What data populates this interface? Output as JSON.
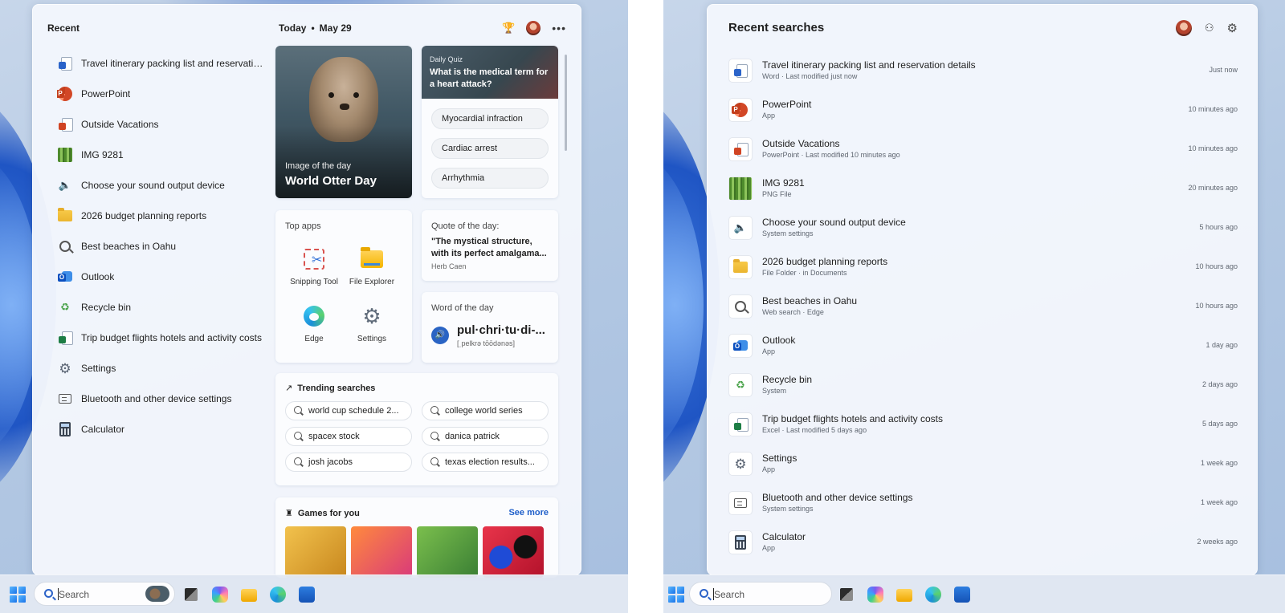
{
  "left": {
    "recent_title": "Recent",
    "recent_items": [
      {
        "label": "Travel itinerary packing list and reservation...",
        "icon": "word-doc-icon"
      },
      {
        "label": "PowerPoint",
        "icon": "powerpoint-icon"
      },
      {
        "label": "Outside Vacations",
        "icon": "powerpoint-file-icon"
      },
      {
        "label": "IMG 9281",
        "icon": "image-thumbnail-icon"
      },
      {
        "label": "Choose your sound output device",
        "icon": "speaker-icon"
      },
      {
        "label": "2026 budget planning reports",
        "icon": "folder-icon"
      },
      {
        "label": "Best beaches in Oahu",
        "icon": "search-icon"
      },
      {
        "label": "Outlook",
        "icon": "outlook-icon"
      },
      {
        "label": "Recycle bin",
        "icon": "recycle-bin-icon"
      },
      {
        "label": "Trip budget flights hotels and activity costs",
        "icon": "excel-file-icon"
      },
      {
        "label": "Settings",
        "icon": "gear-icon"
      },
      {
        "label": "Bluetooth and other device settings",
        "icon": "bluetooth-devices-icon"
      },
      {
        "label": "Calculator",
        "icon": "calculator-icon"
      }
    ],
    "today_label": "Today",
    "today_separator": "•",
    "today_date": "May 29",
    "image_of_day": {
      "subtitle": "Image of the day",
      "title": "World Otter Day"
    },
    "quiz": {
      "category": "Daily Quiz",
      "question": "What is the medical term for a heart attack?",
      "options": [
        "Myocardial infraction",
        "Cardiac arrest",
        "Arrhythmia"
      ]
    },
    "top_apps": {
      "title": "Top apps",
      "apps": [
        {
          "label": "Snipping Tool"
        },
        {
          "label": "File Explorer"
        },
        {
          "label": "Edge"
        },
        {
          "label": "Settings"
        }
      ]
    },
    "quote": {
      "label": "Quote of the day:",
      "line1": "\"The mystical structure,",
      "line2": "with its perfect amalgama...",
      "author": "Herb Caen"
    },
    "word": {
      "label": "Word of the day",
      "word": "pul·chri·tu·di-...",
      "pronunciation": "[ˌpelkrə tōōdənəs]"
    },
    "trending": {
      "title": "Trending searches",
      "items": [
        "world cup schedule 2...",
        "college world series",
        "spacex stock",
        "danica patrick",
        "josh jacobs",
        "texas election results..."
      ]
    },
    "games": {
      "title": "Games for you",
      "see_more": "See more"
    }
  },
  "right": {
    "title": "Recent searches",
    "items": [
      {
        "name": "Travel itinerary packing list and reservation details",
        "sub": "Word · Last modified just now",
        "time": "Just now",
        "icon": "word-doc-icon"
      },
      {
        "name": "PowerPoint",
        "sub": "App",
        "time": "10 minutes ago",
        "icon": "powerpoint-icon"
      },
      {
        "name": "Outside Vacations",
        "sub": "PowerPoint · Last modified 10 minutes ago",
        "time": "10 minutes ago",
        "icon": "powerpoint-file-icon"
      },
      {
        "name": "IMG 9281",
        "sub": "PNG File",
        "time": "20 minutes ago",
        "icon": "image-thumbnail-icon"
      },
      {
        "name": "Choose your sound output device",
        "sub": "System settings",
        "time": "5 hours ago",
        "icon": "speaker-icon"
      },
      {
        "name": "2026 budget planning reports",
        "sub": "File Folder · in Documents",
        "time": "10 hours ago",
        "icon": "folder-icon"
      },
      {
        "name": "Best beaches in Oahu",
        "sub": "Web search · Edge",
        "time": "10 hours ago",
        "icon": "search-icon"
      },
      {
        "name": "Outlook",
        "sub": "App",
        "time": "1 day ago",
        "icon": "outlook-icon"
      },
      {
        "name": "Recycle bin",
        "sub": "System",
        "time": "2 days ago",
        "icon": "recycle-bin-icon"
      },
      {
        "name": "Trip budget flights hotels and activity costs",
        "sub": "Excel · Last modified 5 days ago",
        "time": "5 days ago",
        "icon": "excel-file-icon"
      },
      {
        "name": "Settings",
        "sub": "App",
        "time": "1 week ago",
        "icon": "gear-icon"
      },
      {
        "name": "Bluetooth and other device settings",
        "sub": "System settings",
        "time": "1 week ago",
        "icon": "bluetooth-devices-icon"
      },
      {
        "name": "Calculator",
        "sub": "App",
        "time": "2 weeks ago",
        "icon": "calculator-icon"
      }
    ]
  },
  "taskbar": {
    "search_placeholder": "Search"
  }
}
